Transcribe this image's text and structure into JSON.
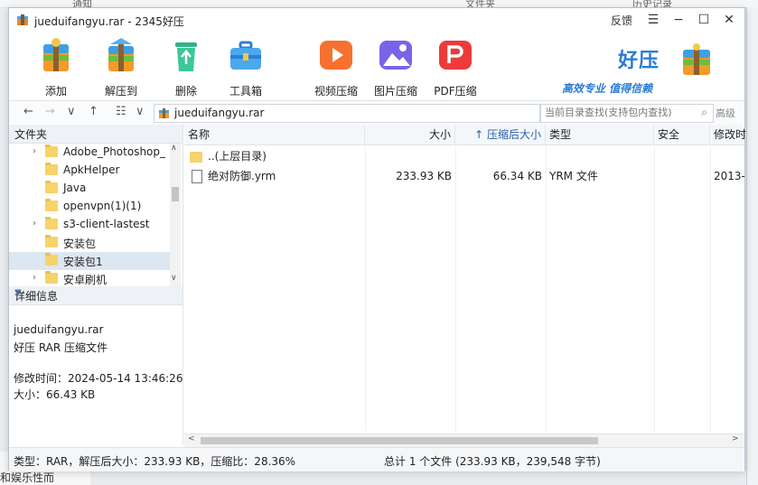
{
  "window": {
    "title": "jueduifangyu.rar - 2345好压",
    "feedback": "反馈",
    "menu_glyph": "☰",
    "min_glyph": "−",
    "max_glyph": "☐",
    "close_glyph": "✕"
  },
  "toolbar": {
    "items": [
      {
        "label": "添加",
        "icon": "add-box-icon"
      },
      {
        "label": "解压到",
        "icon": "extract-box-icon"
      },
      {
        "label": "删除",
        "icon": "recycle-bin-icon"
      },
      {
        "label": "工具箱",
        "icon": "toolbox-icon"
      },
      {
        "label": "视频压缩",
        "icon": "video-compress-icon"
      },
      {
        "label": "图片压缩",
        "icon": "image-compress-icon"
      },
      {
        "label": "PDF压缩",
        "icon": "pdf-compress-icon"
      }
    ],
    "brand_word": "好压",
    "brand_slogan": "高效专业 值得信赖"
  },
  "addressbar": {
    "back": "←",
    "forward": "→",
    "down": "∨",
    "up": "↑",
    "view": "☷",
    "view_dd": "∨",
    "path": "jueduifangyu.rar",
    "search_placeholder": "当前目录查找(支持包内查找)",
    "search_icon": "⌕",
    "advanced": "高级"
  },
  "left": {
    "folders_header": "文件夹",
    "tree": [
      {
        "label": "Adobe_Photoshop_",
        "arrow": "›"
      },
      {
        "label": "ApkHelper",
        "arrow": ""
      },
      {
        "label": "Java",
        "arrow": ""
      },
      {
        "label": "openvpn(1)(1)",
        "arrow": ""
      },
      {
        "label": "s3-client-lastest",
        "arrow": "›"
      },
      {
        "label": "安装包",
        "arrow": ""
      },
      {
        "label": "安装包1",
        "arrow": "",
        "selected": true
      },
      {
        "label": "安卓刷机",
        "arrow": "›"
      }
    ],
    "details_header": "详细信息",
    "details_name": "jueduifangyu.rar",
    "details_type": "好压 RAR 压缩文件",
    "details_modified": "修改时间：2024-05-14 13:46:26",
    "details_size": "大小：66.43 KB",
    "scroll_up": "∧",
    "scroll_down": "∨"
  },
  "filelist": {
    "columns": [
      "名称",
      "大小",
      "↑ 压缩后大小",
      "类型",
      "安全",
      "修改时"
    ],
    "rows": [
      {
        "name": "..(上层目录)",
        "size": "",
        "packed": "",
        "type": "",
        "safe": "",
        "mtime": "",
        "kind": "folder"
      },
      {
        "name": "绝对防御.yrm",
        "size": "233.93 KB",
        "packed": "66.34 KB",
        "type": "YRM 文件",
        "safe": "",
        "mtime": "2013-",
        "kind": "file"
      }
    ],
    "scroll_left": "<",
    "scroll_right": ">"
  },
  "status": {
    "left": "类型：RAR，解压后大小：233.93 KB，压缩比：28.36%",
    "right": "总计 1 个文件 (233.93 KB，239,548 字节)"
  },
  "background": {
    "tab1": "通知",
    "tab2": "文件夹",
    "tab3": "历史记录",
    "left_text": "和娱乐性而"
  },
  "colors": {
    "accent": "#2a7bd8",
    "selection": "#dde7f2",
    "folder": "#f6d36b"
  }
}
